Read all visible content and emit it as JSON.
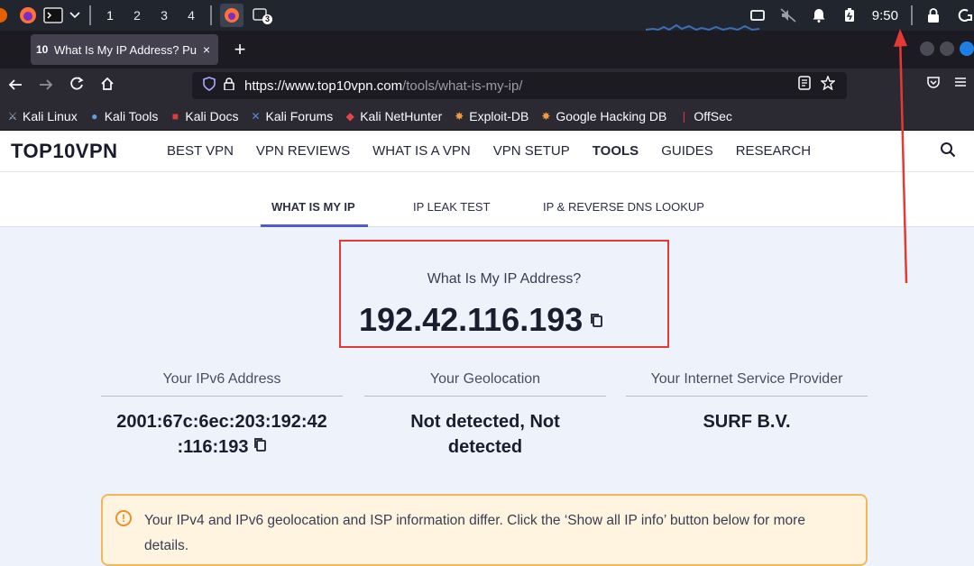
{
  "taskbar": {
    "workspaces": [
      "1",
      "2",
      "3",
      "4"
    ],
    "terminal_badge": "3",
    "clock": "9:50"
  },
  "tab": {
    "favicon": "10",
    "title": "What Is My IP Address? Pu",
    "close": "×",
    "new_tab": "+"
  },
  "nav": {
    "url_host": "https://www.top10vpn.com",
    "url_path": "/tools/what-is-my-ip/"
  },
  "bookmarks": [
    {
      "label": "Kali Linux",
      "icon": "kali-dragon-icon"
    },
    {
      "label": "Kali Tools",
      "icon": "kali-tools-icon"
    },
    {
      "label": "Kali Docs",
      "icon": "kali-docs-icon"
    },
    {
      "label": "Kali Forums",
      "icon": "kali-forums-icon"
    },
    {
      "label": "Kali NetHunter",
      "icon": "nethunter-icon"
    },
    {
      "label": "Exploit-DB",
      "icon": "exploit-db-icon"
    },
    {
      "label": "Google Hacking DB",
      "icon": "ghdb-icon"
    },
    {
      "label": "OffSec",
      "icon": "offsec-icon"
    }
  ],
  "site": {
    "logo": "TOP10VPN",
    "menu": [
      "BEST VPN",
      "VPN REVIEWS",
      "WHAT IS A VPN",
      "VPN SETUP",
      "TOOLS",
      "GUIDES",
      "RESEARCH"
    ],
    "active_menu": "TOOLS"
  },
  "subtabs": [
    "WHAT IS MY IP",
    "IP LEAK TEST",
    "IP & REVERSE DNS LOOKUP"
  ],
  "ip": {
    "label": "What Is My IP Address?",
    "value": "192.42.116.193"
  },
  "info": {
    "ipv6_head": "Your IPv6 Address",
    "ipv6_line1": "2001:67c:6ec:203:192:42",
    "ipv6_line2": ":116:193",
    "geo_head": "Your Geolocation",
    "geo_line1": "Not detected, Not",
    "geo_line2": "detected",
    "isp_head": "Your Internet Service Provider",
    "isp_value": "SURF B.V."
  },
  "warning": {
    "text": "Your IPv4 and IPv6 geolocation and ISP information differ. Click the ‘Show all IP info’ button below for more details."
  },
  "colors": {
    "accent": "#4f5bd5",
    "highlight_box": "#e53935",
    "warning_border": "#f4b65a"
  }
}
